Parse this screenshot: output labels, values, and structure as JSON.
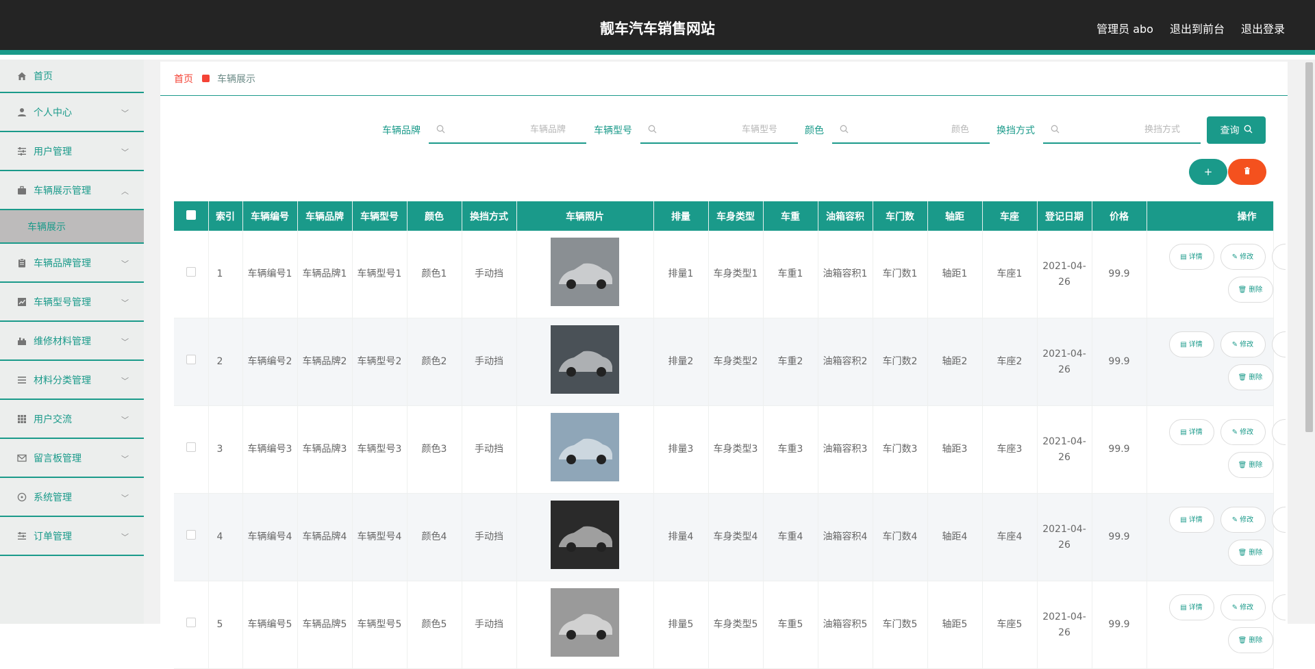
{
  "header": {
    "title": "靓车汽车销售网站",
    "admin": "管理员 abo",
    "to_front": "退出到前台",
    "logout": "退出登录"
  },
  "sidebar": {
    "items": [
      {
        "label": "首页",
        "icon": "home-icon"
      },
      {
        "label": "个人中心",
        "icon": "user-icon"
      },
      {
        "label": "用户管理",
        "icon": "sliders-icon"
      },
      {
        "label": "车辆展示管理",
        "icon": "briefcase-icon",
        "expanded": true
      },
      {
        "label": "车辆品牌管理",
        "icon": "clipboard-icon"
      },
      {
        "label": "车辆型号管理",
        "icon": "chart-icon"
      },
      {
        "label": "维修材料管理",
        "icon": "tools-icon"
      },
      {
        "label": "材料分类管理",
        "icon": "list-icon"
      },
      {
        "label": "用户交流",
        "icon": "grid-icon"
      },
      {
        "label": "留言板管理",
        "icon": "mail-icon"
      },
      {
        "label": "系统管理",
        "icon": "compass-icon"
      },
      {
        "label": "订单管理",
        "icon": "list-icon"
      }
    ],
    "sub_item": "车辆展示"
  },
  "breadcrumb": {
    "home": "首页",
    "current": "车辆展示"
  },
  "search": {
    "brand_label": "车辆品牌",
    "brand_placeholder": "车辆品牌",
    "model_label": "车辆型号",
    "model_placeholder": "车辆型号",
    "color_label": "颜色",
    "color_placeholder": "颜色",
    "gear_label": "换挡方式",
    "gear_placeholder": "换挡方式",
    "query_label": "查询"
  },
  "actions": {
    "add_label": "+",
    "delete_label": "🗑"
  },
  "table": {
    "headers": {
      "index": "索引",
      "number": "车辆编号",
      "brand": "车辆品牌",
      "model": "车辆型号",
      "color": "颜色",
      "gear": "换挡方式",
      "photo": "车辆照片",
      "displacement": "排量",
      "body": "车身类型",
      "weight": "车重",
      "tank": "油箱容积",
      "doors": "车门数",
      "wheelbase": "轴距",
      "seats": "车座",
      "date": "登记日期",
      "price": "价格",
      "ops": "操作"
    },
    "op_detail": "详情",
    "op_edit": "修改",
    "op_delete": "删除",
    "rows": [
      {
        "index": "1",
        "number": "车辆编号1",
        "brand": "车辆品牌1",
        "model": "车辆型号1",
        "color": "颜色1",
        "gear": "手动挡",
        "displacement": "排量1",
        "body": "车身类型1",
        "weight": "车重1",
        "tank": "油箱容积1",
        "doors": "车门数1",
        "wheelbase": "轴距1",
        "seats": "车座1",
        "date": "2021-04-26",
        "price": "99.9",
        "photo_color": "#8a8f93"
      },
      {
        "index": "2",
        "number": "车辆编号2",
        "brand": "车辆品牌2",
        "model": "车辆型号2",
        "color": "颜色2",
        "gear": "手动挡",
        "displacement": "排量2",
        "body": "车身类型2",
        "weight": "车重2",
        "tank": "油箱容积2",
        "doors": "车门数2",
        "wheelbase": "轴距2",
        "seats": "车座2",
        "date": "2021-04-26",
        "price": "99.9",
        "photo_color": "#4a5157"
      },
      {
        "index": "3",
        "number": "车辆编号3",
        "brand": "车辆品牌3",
        "model": "车辆型号3",
        "color": "颜色3",
        "gear": "手动挡",
        "displacement": "排量3",
        "body": "车身类型3",
        "weight": "车重3",
        "tank": "油箱容积3",
        "doors": "车门数3",
        "wheelbase": "轴距3",
        "seats": "车座3",
        "date": "2021-04-26",
        "price": "99.9",
        "photo_color": "#8fa6b8"
      },
      {
        "index": "4",
        "number": "车辆编号4",
        "brand": "车辆品牌4",
        "model": "车辆型号4",
        "color": "颜色4",
        "gear": "手动挡",
        "displacement": "排量4",
        "body": "车身类型4",
        "weight": "车重4",
        "tank": "油箱容积4",
        "doors": "车门数4",
        "wheelbase": "轴距4",
        "seats": "车座4",
        "date": "2021-04-26",
        "price": "99.9",
        "photo_color": "#2a2a2a"
      },
      {
        "index": "5",
        "number": "车辆编号5",
        "brand": "车辆品牌5",
        "model": "车辆型号5",
        "color": "颜色5",
        "gear": "手动挡",
        "displacement": "排量5",
        "body": "车身类型5",
        "weight": "车重5",
        "tank": "油箱容积5",
        "doors": "车门数5",
        "wheelbase": "轴距5",
        "seats": "车座5",
        "date": "2021-04-26",
        "price": "99.9",
        "photo_color": "#9a9a9a"
      }
    ]
  },
  "colors": {
    "accent": "#1a9a8a",
    "danger": "#f4511e",
    "header_bg": "#242424"
  }
}
